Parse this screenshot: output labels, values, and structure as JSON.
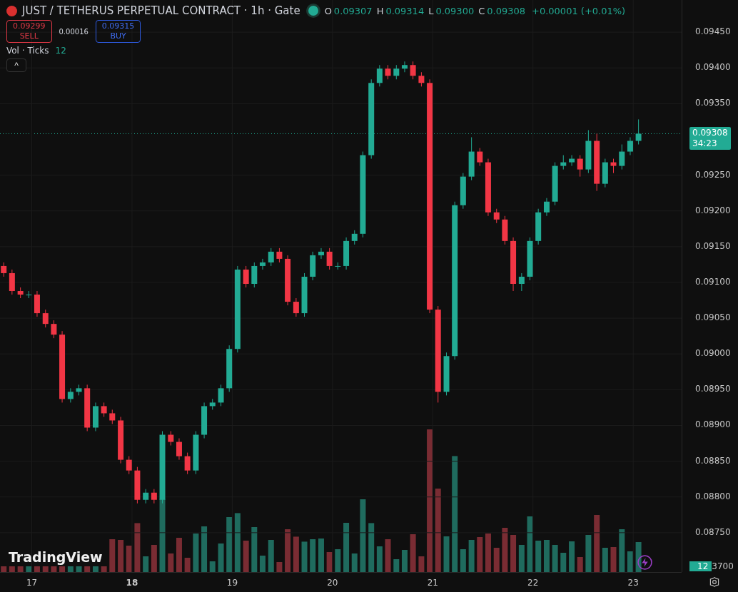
{
  "header": {
    "title": "JUST / TETHERUS PERPETUAL CONTRACT · 1h · Gate",
    "ohlc": [
      {
        "key": "O",
        "value": "0.09307"
      },
      {
        "key": "H",
        "value": "0.09314"
      },
      {
        "key": "L",
        "value": "0.09300"
      },
      {
        "key": "C",
        "value": "0.09308"
      }
    ],
    "change": "+0.00001 (+0.01%)"
  },
  "trade": {
    "sell_price": "0.09299",
    "sell_label": "SELL",
    "spread": "0.00016",
    "buy_price": "0.09315",
    "buy_label": "BUY"
  },
  "indicator": {
    "name": "Vol · Ticks",
    "value": "12"
  },
  "collapse_button": "^",
  "price_label": {
    "price": "0.09308",
    "countdown": "34:23"
  },
  "volume_badge": {
    "value": "12",
    "covered_tick": "3700"
  },
  "logo": "TradingView",
  "chart_data": {
    "type": "candlestick",
    "xlim": [
      16.683,
      23.483
    ],
    "ylim": [
      0.08695,
      0.09495
    ],
    "x": [
      16.72,
      16.803,
      16.887,
      16.97,
      17.053,
      17.137,
      17.22,
      17.303,
      17.387,
      17.47,
      17.553,
      17.637,
      17.72,
      17.803,
      17.887,
      17.97,
      18.053,
      18.137,
      18.22,
      18.303,
      18.387,
      18.47,
      18.553,
      18.637,
      18.72,
      18.803,
      18.887,
      18.97,
      19.053,
      19.137,
      19.22,
      19.303,
      19.387,
      19.47,
      19.553,
      19.637,
      19.72,
      19.803,
      19.887,
      19.97,
      20.053,
      20.137,
      20.22,
      20.303,
      20.387,
      20.47,
      20.553,
      20.637,
      20.72,
      20.803,
      20.887,
      20.97,
      21.053,
      21.137,
      21.22,
      21.303,
      21.387,
      21.47,
      21.553,
      21.637,
      21.72,
      21.803,
      21.887,
      21.97,
      22.053,
      22.137,
      22.22,
      22.303,
      22.387,
      22.47,
      22.553,
      22.637,
      22.72,
      22.803,
      22.887,
      22.97,
      23.053
    ],
    "ohlc": [
      [
        0.09123,
        0.09128,
        0.09108,
        0.09113
      ],
      [
        0.09113,
        0.09118,
        0.09083,
        0.09088
      ],
      [
        0.09088,
        0.09093,
        0.09078,
        0.09083
      ],
      [
        0.09083,
        0.09088,
        0.09078,
        0.09083
      ],
      [
        0.09083,
        0.09088,
        0.09052,
        0.09057
      ],
      [
        0.09057,
        0.09062,
        0.09037,
        0.09042
      ],
      [
        0.09042,
        0.09047,
        0.09022,
        0.09027
      ],
      [
        0.09027,
        0.09032,
        0.08932,
        0.08937
      ],
      [
        0.08937,
        0.08952,
        0.08932,
        0.08947
      ],
      [
        0.08947,
        0.08957,
        0.08942,
        0.08952
      ],
      [
        0.08952,
        0.08957,
        0.08892,
        0.08897
      ],
      [
        0.08897,
        0.08932,
        0.08892,
        0.08927
      ],
      [
        0.08927,
        0.08932,
        0.08912,
        0.08917
      ],
      [
        0.08917,
        0.08922,
        0.08902,
        0.08907
      ],
      [
        0.08907,
        0.08912,
        0.08847,
        0.08852
      ],
      [
        0.08852,
        0.08857,
        0.08832,
        0.08837
      ],
      [
        0.08837,
        0.08842,
        0.08791,
        0.08796
      ],
      [
        0.08796,
        0.08811,
        0.08791,
        0.08806
      ],
      [
        0.08806,
        0.08811,
        0.08791,
        0.08796
      ],
      [
        0.08796,
        0.08892,
        0.08791,
        0.08887
      ],
      [
        0.08887,
        0.08892,
        0.08872,
        0.08877
      ],
      [
        0.08877,
        0.08882,
        0.08852,
        0.08857
      ],
      [
        0.08857,
        0.08862,
        0.08832,
        0.08837
      ],
      [
        0.08837,
        0.08892,
        0.08832,
        0.08887
      ],
      [
        0.08887,
        0.08932,
        0.08882,
        0.08927
      ],
      [
        0.08927,
        0.08937,
        0.08922,
        0.08932
      ],
      [
        0.08932,
        0.08957,
        0.08927,
        0.08952
      ],
      [
        0.08952,
        0.09012,
        0.08947,
        0.09007
      ],
      [
        0.09007,
        0.09123,
        0.09002,
        0.09118
      ],
      [
        0.09118,
        0.09123,
        0.09093,
        0.09098
      ],
      [
        0.09098,
        0.09128,
        0.09093,
        0.09123
      ],
      [
        0.09123,
        0.09133,
        0.09118,
        0.09128
      ],
      [
        0.09128,
        0.09148,
        0.09123,
        0.09143
      ],
      [
        0.09143,
        0.09148,
        0.09128,
        0.09133
      ],
      [
        0.09133,
        0.09138,
        0.09068,
        0.09073
      ],
      [
        0.09073,
        0.09078,
        0.09052,
        0.09057
      ],
      [
        0.09057,
        0.09113,
        0.09052,
        0.09108
      ],
      [
        0.09108,
        0.09143,
        0.09103,
        0.09138
      ],
      [
        0.09138,
        0.09148,
        0.09133,
        0.09143
      ],
      [
        0.09143,
        0.09148,
        0.09118,
        0.09123
      ],
      [
        0.09123,
        0.09128,
        0.09118,
        0.09123
      ],
      [
        0.09123,
        0.09163,
        0.09118,
        0.09158
      ],
      [
        0.09158,
        0.09173,
        0.09153,
        0.09168
      ],
      [
        0.09168,
        0.09283,
        0.09163,
        0.09278
      ],
      [
        0.09278,
        0.09384,
        0.09273,
        0.09379
      ],
      [
        0.09379,
        0.09404,
        0.09374,
        0.09399
      ],
      [
        0.09399,
        0.09404,
        0.09384,
        0.09389
      ],
      [
        0.09389,
        0.09404,
        0.09384,
        0.09399
      ],
      [
        0.09399,
        0.09409,
        0.09394,
        0.09404
      ],
      [
        0.09404,
        0.09409,
        0.09384,
        0.09389
      ],
      [
        0.09389,
        0.09394,
        0.09374,
        0.09379
      ],
      [
        0.09379,
        0.09384,
        0.09057,
        0.09062
      ],
      [
        0.09062,
        0.09067,
        0.08932,
        0.08947
      ],
      [
        0.08947,
        0.09002,
        0.08942,
        0.08997
      ],
      [
        0.08997,
        0.09213,
        0.08992,
        0.09208
      ],
      [
        0.09208,
        0.09253,
        0.09203,
        0.09248
      ],
      [
        0.09248,
        0.09303,
        0.09243,
        0.09283
      ],
      [
        0.09283,
        0.09288,
        0.09263,
        0.09268
      ],
      [
        0.09268,
        0.09273,
        0.09193,
        0.09198
      ],
      [
        0.09198,
        0.09203,
        0.09183,
        0.09188
      ],
      [
        0.09188,
        0.09193,
        0.09153,
        0.09158
      ],
      [
        0.09158,
        0.09163,
        0.09088,
        0.09098
      ],
      [
        0.09098,
        0.09113,
        0.09088,
        0.09108
      ],
      [
        0.09108,
        0.09163,
        0.09103,
        0.09158
      ],
      [
        0.09158,
        0.09203,
        0.09153,
        0.09198
      ],
      [
        0.09198,
        0.09218,
        0.09193,
        0.09213
      ],
      [
        0.09213,
        0.09268,
        0.09208,
        0.09263
      ],
      [
        0.09263,
        0.09278,
        0.09258,
        0.09268
      ],
      [
        0.09268,
        0.09278,
        0.09263,
        0.09273
      ],
      [
        0.09273,
        0.09278,
        0.09248,
        0.09258
      ],
      [
        0.09258,
        0.09313,
        0.09253,
        0.09298
      ],
      [
        0.09298,
        0.09308,
        0.09228,
        0.09238
      ],
      [
        0.09238,
        0.09273,
        0.09233,
        0.09268
      ],
      [
        0.09268,
        0.09273,
        0.09253,
        0.09263
      ],
      [
        0.09263,
        0.09293,
        0.09258,
        0.09283
      ],
      [
        0.09283,
        0.09303,
        0.09278,
        0.09298
      ],
      [
        0.09298,
        0.09328,
        0.09293,
        0.09308
      ]
    ],
    "xticks": [
      17,
      18,
      19,
      20,
      21,
      22,
      23
    ],
    "grid": true,
    "yticks": [
      {
        "value": 0.0875,
        "label": "0.08750"
      },
      {
        "value": 0.088,
        "label": "0.08800"
      },
      {
        "value": 0.0885,
        "label": "0.08850"
      },
      {
        "value": 0.089,
        "label": "0.08900"
      },
      {
        "value": 0.0895,
        "label": "0.08950"
      },
      {
        "value": 0.09,
        "label": "0.09000"
      },
      {
        "value": 0.0905,
        "label": "0.09050"
      },
      {
        "value": 0.091,
        "label": "0.09100"
      },
      {
        "value": 0.0915,
        "label": "0.09150"
      },
      {
        "value": 0.092,
        "label": "0.09200"
      },
      {
        "value": 0.0925,
        "label": "0.09250"
      },
      {
        "value": 0.0935,
        "label": "0.09350"
      },
      {
        "value": 0.094,
        "label": "0.09400"
      },
      {
        "value": 0.0945,
        "label": "0.09450"
      }
    ]
  }
}
